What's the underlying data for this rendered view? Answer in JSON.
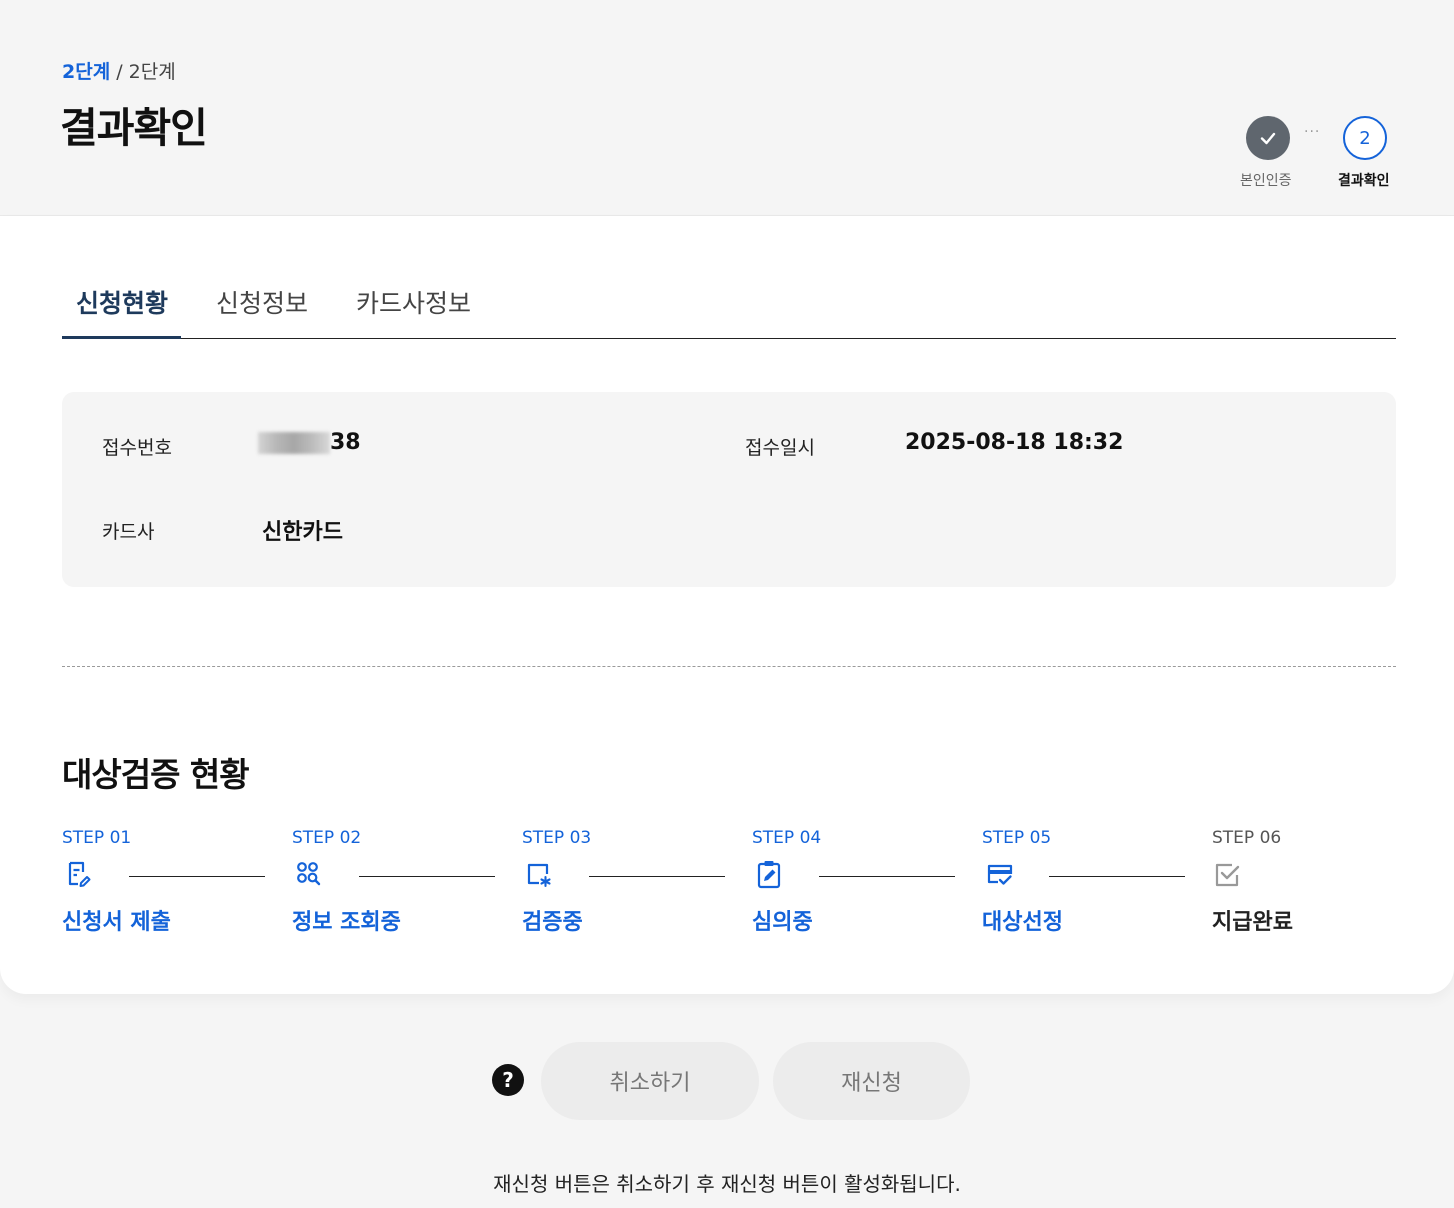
{
  "header": {
    "step_current": "2단계",
    "step_separator": " / ",
    "step_total": "2단계",
    "title": "결과확인",
    "progress": {
      "step1_label": "본인인증",
      "step1_icon": "check-icon",
      "dots": "···",
      "step2_number": "2",
      "step2_label": "결과확인"
    }
  },
  "tabs": [
    {
      "label": "신청현황",
      "active": true
    },
    {
      "label": "신청정보",
      "active": false
    },
    {
      "label": "카드사정보",
      "active": false
    }
  ],
  "info": {
    "receipt_number_label": "접수번호",
    "receipt_number_suffix": "38",
    "receipt_datetime_label": "접수일시",
    "receipt_datetime": "2025-08-18 18:32",
    "card_company_label": "카드사",
    "card_company": "신한카드"
  },
  "verification": {
    "title": "대상검증 현황",
    "steps": [
      {
        "number": "STEP 01",
        "name": "신청서 제출",
        "icon": "form-edit-icon",
        "done": true
      },
      {
        "number": "STEP 02",
        "name": "정보 조회중",
        "icon": "search-grid-icon",
        "done": true
      },
      {
        "number": "STEP 03",
        "name": "검증중",
        "icon": "verify-frame-icon",
        "done": true
      },
      {
        "number": "STEP 04",
        "name": "심의중",
        "icon": "clipboard-edit-icon",
        "done": true
      },
      {
        "number": "STEP 05",
        "name": "대상선정",
        "icon": "card-check-icon",
        "done": true
      },
      {
        "number": "STEP 06",
        "name": "지급완료",
        "icon": "checkbox-icon",
        "done": false
      }
    ]
  },
  "actions": {
    "help_label": "?",
    "cancel_label": "취소하기",
    "reapply_label": "재신청",
    "notice": "재신청 버튼은 취소하기 후 재신청 버튼이 활성화됩니다."
  },
  "colors": {
    "accent": "#1463d9",
    "tab_active": "#1e3a5c",
    "button_disabled_bg": "#ececec",
    "progress_done": "#5f666e"
  }
}
